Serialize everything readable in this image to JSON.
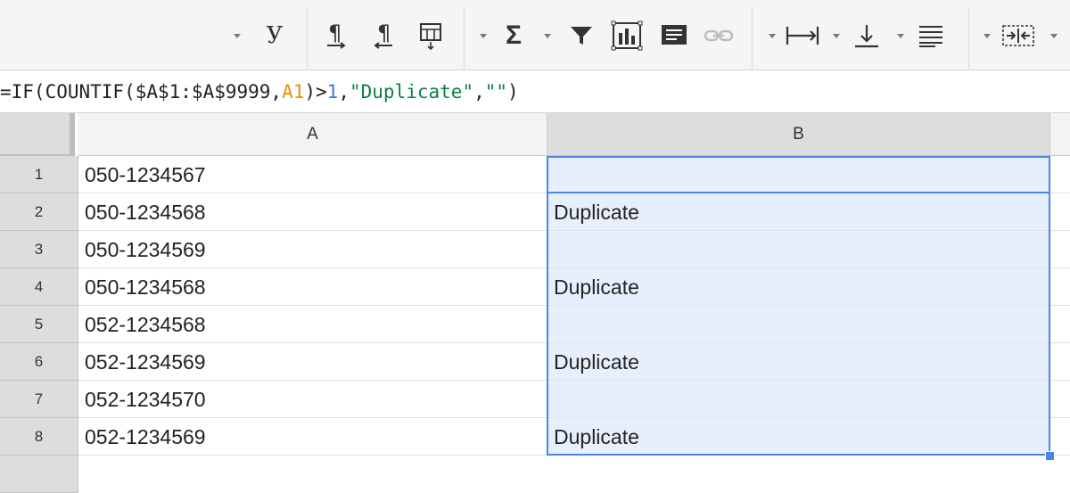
{
  "toolbar": {
    "font_button_label": "У",
    "icons": [
      "dropdown-arrow",
      "text-direction-ltr-icon",
      "text-direction-rtl-icon",
      "text-rotation-icon",
      "sum-icon",
      "filter-icon",
      "insert-chart-icon",
      "insert-comment-icon",
      "link-icon",
      "horizontal-align-icon",
      "vertical-align-icon",
      "text-wrap-icon",
      "merge-cells-icon"
    ]
  },
  "formula_bar": {
    "parts": [
      "=IF(COUNTIF($A$1:$A$9999,",
      "A1",
      ")>",
      "1",
      ",",
      "\"Duplicate\"",
      ",",
      "\"\"",
      ")"
    ]
  },
  "columns": [
    "A",
    "B"
  ],
  "rows": [
    {
      "num": "1",
      "a": "050-1234567",
      "b": ""
    },
    {
      "num": "2",
      "a": "050-1234568",
      "b": "Duplicate"
    },
    {
      "num": "3",
      "a": "050-1234569",
      "b": ""
    },
    {
      "num": "4",
      "a": "050-1234568",
      "b": "Duplicate"
    },
    {
      "num": "5",
      "a": "052-1234568",
      "b": ""
    },
    {
      "num": "6",
      "a": "052-1234569",
      "b": "Duplicate"
    },
    {
      "num": "7",
      "a": "052-1234570",
      "b": ""
    },
    {
      "num": "8",
      "a": "052-1234569",
      "b": "Duplicate"
    }
  ],
  "colors": {
    "selection": "#4a86e8",
    "selected_fill": "#e8effc",
    "formula_ref": "#ef8f00",
    "formula_number": "#3b78e7",
    "formula_string": "#0b8043"
  }
}
